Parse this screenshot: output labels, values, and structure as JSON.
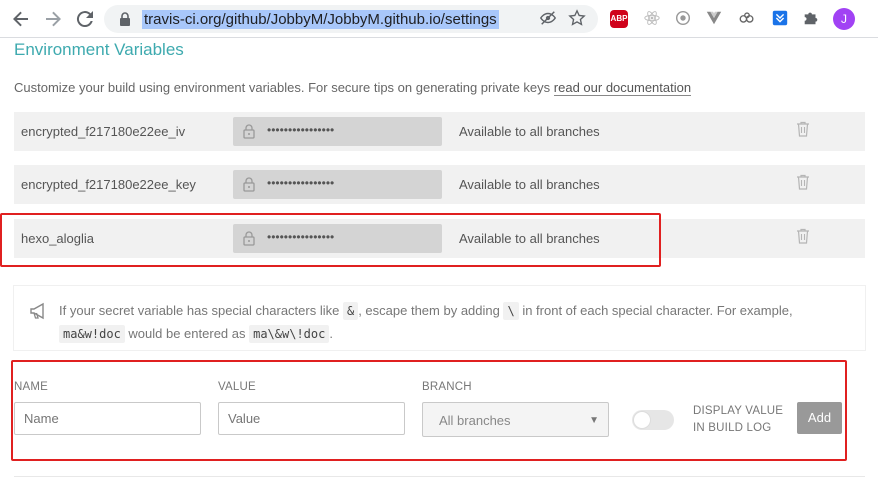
{
  "browser": {
    "url": "travis-ci.org/github/JobbyM/JobbyM.github.io/settings",
    "avatar_letter": "J",
    "abp_label": "ABP"
  },
  "section": {
    "title": "Environment Variables",
    "intro_text": "Customize your build using environment variables. For secure tips on generating private keys ",
    "intro_link": "read our documentation"
  },
  "env_vars": [
    {
      "name": "encrypted_f217180e22ee_iv",
      "value": "••••••••••••••••",
      "branch": "Available to all branches"
    },
    {
      "name": "encrypted_f217180e22ee_key",
      "value": "••••••••••••••••",
      "branch": "Available to all branches"
    },
    {
      "name": "hexo_aloglia",
      "value": "••••••••••••••••",
      "branch": "Available to all branches"
    }
  ],
  "notice": {
    "part1": "If your secret variable has special characters like ",
    "code1": "&",
    "part2": ", escape them by adding ",
    "code2": "\\",
    "part3": " in front of each special character. For example, ",
    "code3": "ma&w!doc",
    "part4": " would be entered as ",
    "code4": "ma\\&w\\!doc",
    "part5": "."
  },
  "form": {
    "name_label": "NAME",
    "name_placeholder": "Name",
    "value_label": "VALUE",
    "value_placeholder": "Value",
    "branch_label": "BRANCH",
    "branch_selected": "All branches",
    "display_line1": "DISPLAY VALUE",
    "display_line2": "IN BUILD LOG",
    "add_label": "Add"
  },
  "colors": {
    "accent": "#3eaaaf",
    "highlight_border": "#e02020",
    "add_button": "#999999"
  }
}
